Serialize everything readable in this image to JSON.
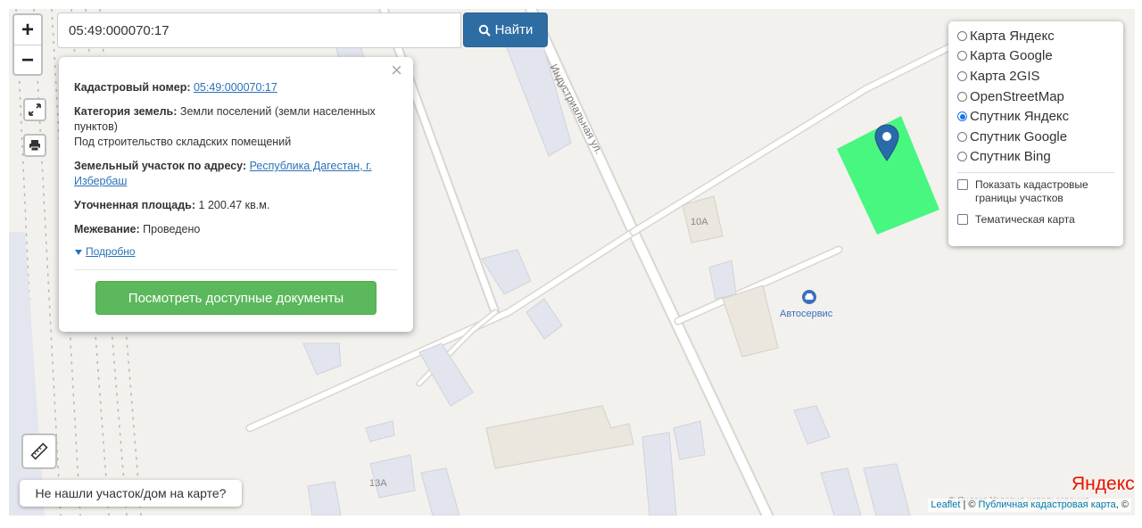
{
  "search": {
    "value": "05:49:000070:17",
    "button_label": "Найти"
  },
  "popup": {
    "cadastral_label": "Кадастровый номер:",
    "cadastral_value": "05:49:000070:17",
    "category_label": "Категория земель:",
    "category_value": "Земли поселений (земли населенных пунктов)",
    "usage_value": "Под строительство складских помещений",
    "address_label": "Земельный участок по адресу:",
    "address_value": "Республика Дагестан, г. Избербаш",
    "area_label": "Уточненная площадь:",
    "area_value": "1 200.47 кв.м.",
    "survey_label": "Межевание:",
    "survey_value": "Проведено",
    "more_label": "Подробно",
    "docs_button": "Посмотреть доступные документы"
  },
  "layers": {
    "options": [
      {
        "label": "Карта Яндекс",
        "selected": false
      },
      {
        "label": "Карта Google",
        "selected": false
      },
      {
        "label": "Карта 2GIS",
        "selected": false
      },
      {
        "label": "OpenStreetMap",
        "selected": false
      },
      {
        "label": "Спутник Яндекс",
        "selected": true
      },
      {
        "label": "Спутник Google",
        "selected": false
      },
      {
        "label": "Спутник Bing",
        "selected": false
      }
    ],
    "checkbox_borders": "Показать кадастровые границы участков",
    "checkbox_thematic": "Тематическая карта"
  },
  "map": {
    "street_label": "Индустриальная ул.",
    "building_10a": "10А",
    "building_13a": "13А",
    "poi_label": "Автосервис",
    "parcel_color": "#3ef77a",
    "marker_color": "#2a6aaa"
  },
  "controls": {
    "zoom_in": "+",
    "zoom_out": "−",
    "not_found": "Не нашли участок/дом на карте?"
  },
  "attribution": {
    "leaflet": "Leaflet",
    "separator": " | © ",
    "cadastral_map": "Публичная кадастровая карта",
    "tail": ", ©",
    "yandex_logo": "Яндекс",
    "yandex_terms": "© Яндекс  Условия использования"
  }
}
